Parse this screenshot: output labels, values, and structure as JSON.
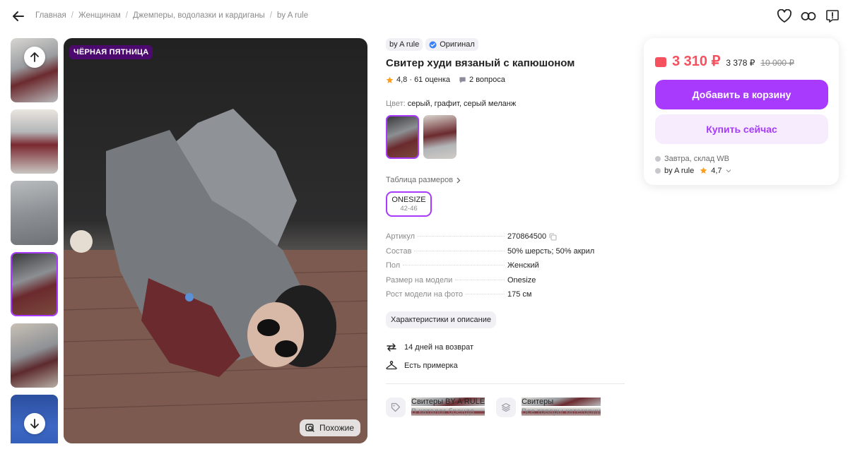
{
  "breadcrumbs": [
    "Главная",
    "Женщинам",
    "Джемперы, водолазки и кардиганы",
    "by A rule"
  ],
  "gallery": {
    "promo_badge": "ЧЁРНАЯ ПЯТНИЦА",
    "similar_label": "Похожие"
  },
  "product": {
    "brand": "by A rule",
    "original_label": "Оригинал",
    "title": "Свитер худи вязаный с капюшоном",
    "rating": "4,8 · 61 оценка",
    "questions": "2 вопроса",
    "color_label": "Цвет:",
    "color_value": "серый, графит, серый меланж",
    "size_table_label": "Таблица размеров",
    "size": {
      "name": "ONESIZE",
      "range": "42-46"
    },
    "specs": [
      {
        "key": "Артикул",
        "value": "270864500"
      },
      {
        "key": "Состав",
        "value": "50% шерсть; 50% акрил"
      },
      {
        "key": "Пол",
        "value": "Женский"
      },
      {
        "key": "Размер на модели",
        "value": "Onesize"
      },
      {
        "key": "Рост модели на фото",
        "value": "175 см"
      }
    ],
    "specs_button": "Характеристики и описание",
    "perks": {
      "return": "14 дней на возврат",
      "fitting": "Есть примерка"
    },
    "links": [
      {
        "title": "Свитеры BY A RULE",
        "subtitle": "В каталог бренда"
      },
      {
        "title": "Свитеры",
        "subtitle": "Все товары категории"
      }
    ]
  },
  "buy_box": {
    "price": "3 310 ₽",
    "price_no_wallet": "3 378 ₽",
    "price_old": "10 000 ₽",
    "add_to_cart": "Добавить в корзину",
    "buy_now": "Купить сейчас",
    "delivery": "Завтра, склад WB",
    "seller": "by A rule",
    "seller_rating": "4,7"
  },
  "colors": {
    "accent": "#a73afd",
    "price": "#f5515f",
    "promo": "#4d0a6e"
  }
}
